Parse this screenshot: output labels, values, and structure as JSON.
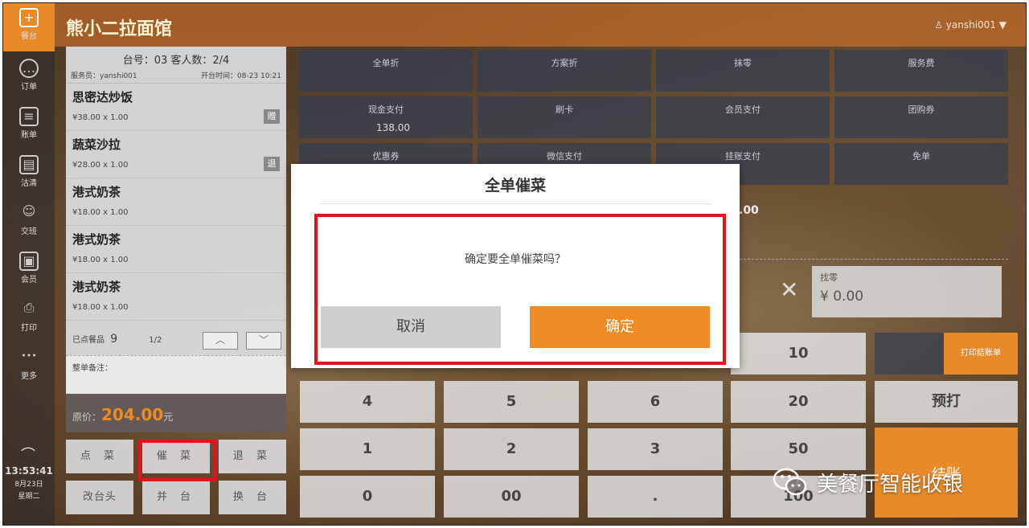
{
  "app": {
    "shop_name": "熊小二拉面馆",
    "user": "yanshi001"
  },
  "rail": [
    {
      "label": "餐台",
      "icon": "plus-square-icon",
      "glyph": "+"
    },
    {
      "label": "订单",
      "icon": "chat-icon",
      "glyph": "…"
    },
    {
      "label": "账单",
      "icon": "bill-icon",
      "glyph": "≡"
    },
    {
      "label": "沽清",
      "icon": "document-icon",
      "glyph": "▤"
    },
    {
      "label": "交班",
      "icon": "person-icon",
      "glyph": "☺"
    },
    {
      "label": "会员",
      "icon": "member-card-icon",
      "glyph": "▣"
    },
    {
      "label": "打印",
      "icon": "printer-icon",
      "glyph": "⎙"
    },
    {
      "label": "更多",
      "icon": "more-dots-icon",
      "glyph": "•••"
    }
  ],
  "clock": {
    "time": "13:53:41",
    "date": "8月23日",
    "weekday": "星期二"
  },
  "order": {
    "table": "台号：03  客人数：2/4",
    "waiter": "服务员：yanshi001",
    "open_time": "开台时间：08-23 10:21",
    "items": [
      {
        "name": "思密达炒饭",
        "price": "¥38.00  x 1.00",
        "tag": "赠"
      },
      {
        "name": "蔬菜沙拉",
        "price": "¥28.00  x 1.00",
        "tag": "退"
      },
      {
        "name": "港式奶茶",
        "price": "¥18.00  x 1.00",
        "tag": ""
      },
      {
        "name": "港式奶茶",
        "price": "¥18.00  x 1.00",
        "tag": ""
      },
      {
        "name": "港式奶茶",
        "price": "¥18.00  x 1.00",
        "tag": ""
      }
    ],
    "ordered_label": "已点餐品",
    "ordered_count": "9",
    "page": "1/2",
    "note_label": "整单备注：",
    "total_label": "原价：",
    "total_value": "204.00",
    "total_unit": "元"
  },
  "left_buttons": [
    "点 菜",
    "催 菜",
    "退 菜",
    "改台头",
    "并 台",
    "换 台"
  ],
  "discounts": [
    "全单折",
    "方案折",
    "抹零",
    "服务费"
  ],
  "payments": [
    {
      "label": "现金支付",
      "amount": "138.00"
    },
    {
      "label": "刷卡",
      "amount": ""
    },
    {
      "label": "会员支付",
      "amount": ""
    },
    {
      "label": "团购券",
      "amount": ""
    },
    {
      "label": "优惠券",
      "amount": ""
    },
    {
      "label": "微信支付",
      "amount": ""
    },
    {
      "label": "挂账支付",
      "amount": ""
    },
    {
      "label": "免单",
      "amount": ""
    }
  ],
  "partial_amount": ".00",
  "change": {
    "label": "找零",
    "value": "¥ 0.00"
  },
  "keypad": [
    "10",
    "4",
    "5",
    "6",
    "20",
    "1",
    "2",
    "3",
    "50",
    "0",
    "00",
    ".",
    "100"
  ],
  "print_bill": "打印结账单",
  "preprint": "预打",
  "checkout": "结账",
  "dialog": {
    "title": "全单催菜",
    "message": "确定要全单催菜吗？",
    "cancel": "取消",
    "confirm": "确定"
  },
  "watermark": "美餐厅智能收银"
}
